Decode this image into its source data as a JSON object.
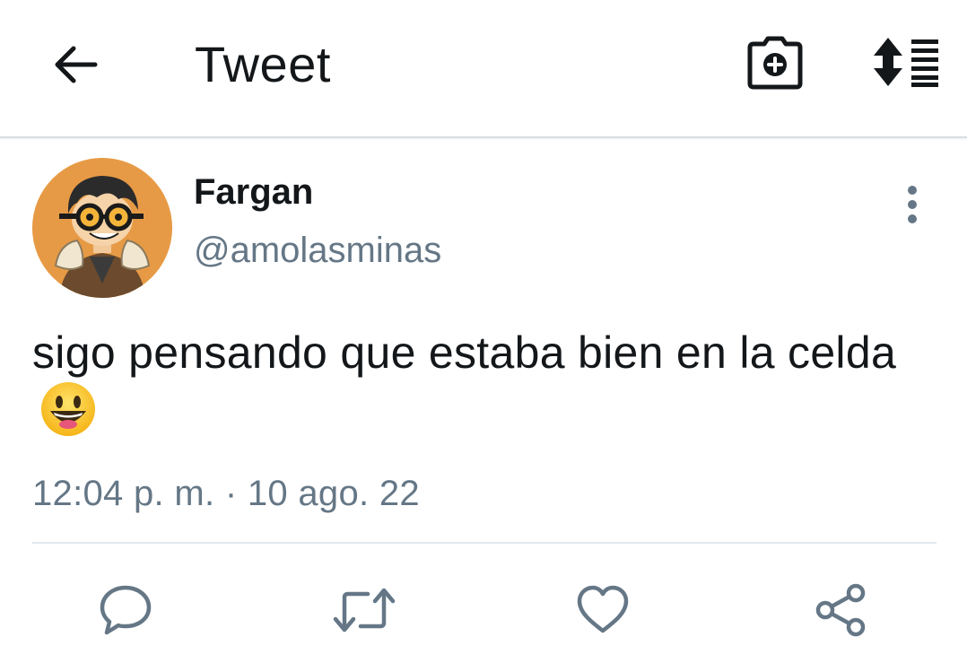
{
  "header": {
    "title": "Tweet",
    "back_icon": "arrow-left-icon",
    "camera_icon": "camera-plus-icon",
    "sort_icon": "sort-list-icon"
  },
  "tweet": {
    "author_name": "Fargan",
    "author_handle": "@amolasminas",
    "text": "sigo pensando que estaba bien en la celda",
    "emoji": "grinning-face-emoji",
    "timestamp": "12:04 p. m. · 10 ago. 22"
  },
  "actions": {
    "reply_icon": "reply-icon",
    "retweet_icon": "retweet-icon",
    "like_icon": "heart-icon",
    "share_icon": "share-icon"
  },
  "colors": {
    "text_primary": "#14171a",
    "text_secondary": "#657786",
    "icon_gray": "#657786",
    "avatar_bg": "#e79a45",
    "divider": "#e1e8ed"
  }
}
